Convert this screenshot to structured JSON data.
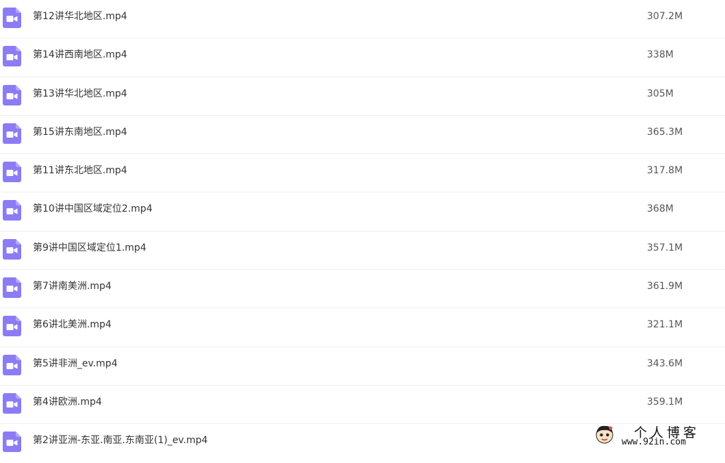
{
  "file_list": {
    "icon": "video-file-icon",
    "icon_color": "#8b7cf6",
    "items": [
      {
        "name": "第12讲华北地区.mp4",
        "size": "307.2M"
      },
      {
        "name": "第14讲西南地区.mp4",
        "size": "338M"
      },
      {
        "name": "第13讲华北地区.mp4",
        "size": "305M"
      },
      {
        "name": "第15讲东南地区.mp4",
        "size": "365.3M"
      },
      {
        "name": "第11讲东北地区.mp4",
        "size": "317.8M"
      },
      {
        "name": "第10讲中国区域定位2.mp4",
        "size": "368M"
      },
      {
        "name": "第9讲中国区域定位1.mp4",
        "size": "357.1M"
      },
      {
        "name": "第7讲南美洲.mp4",
        "size": "361.9M"
      },
      {
        "name": "第6讲北美洲.mp4",
        "size": "321.1M"
      },
      {
        "name": "第5讲非洲_ev.mp4",
        "size": "343.6M"
      },
      {
        "name": "第4讲欧洲.mp4",
        "size": "359.1M"
      },
      {
        "name": "第2讲亚洲-东亚.南亚.东南亚(1)_ev.mp4",
        "size": ""
      }
    ]
  },
  "watermark": {
    "title": "个人博客",
    "url": "www.92in.com"
  }
}
